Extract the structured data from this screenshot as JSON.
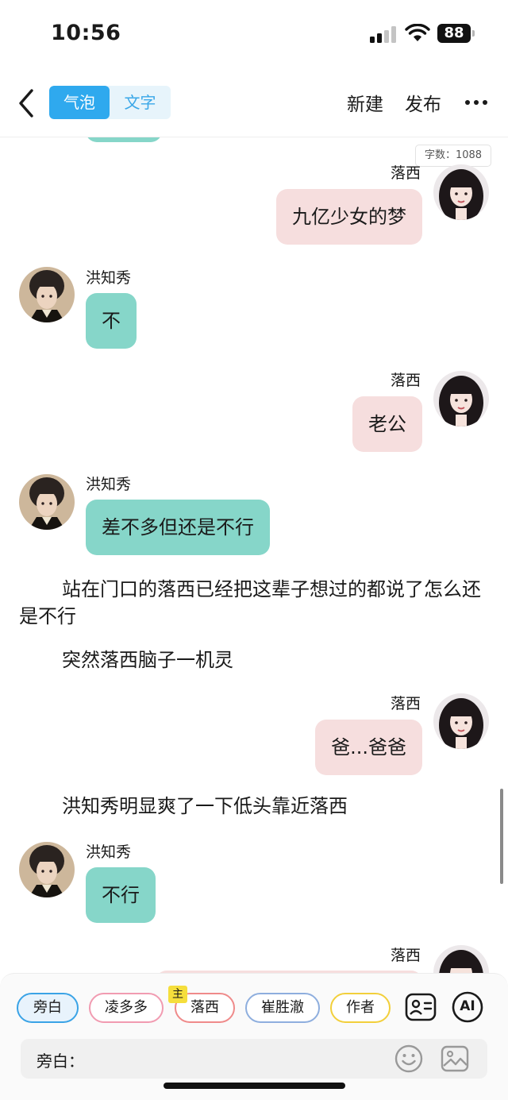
{
  "status_bar": {
    "time": "10:56",
    "battery": "88"
  },
  "nav": {
    "tabs": [
      {
        "label": "气泡"
      },
      {
        "label": "文字"
      }
    ],
    "new_label": "新建",
    "publish_label": "发布"
  },
  "word_count": "字数：1088",
  "messages": [
    {
      "type": "bubble",
      "side": "right",
      "name": "落西",
      "text": "九亿少女的梦"
    },
    {
      "type": "bubble",
      "side": "left",
      "name": "洪知秀",
      "text": "不"
    },
    {
      "type": "bubble",
      "side": "right",
      "name": "落西",
      "text": "老公"
    },
    {
      "type": "bubble",
      "side": "left",
      "name": "洪知秀",
      "text": "差不多但还是不行"
    },
    {
      "type": "narration",
      "text": "站在门口的落西已经把这辈子想过的都说了怎么还是不行"
    },
    {
      "type": "narration",
      "text": "突然落西脑子一机灵"
    },
    {
      "type": "bubble",
      "side": "right",
      "name": "落西",
      "text": "爸...爸爸"
    },
    {
      "type": "narration",
      "text": "洪知秀明显爽了一下低头靠近落西"
    },
    {
      "type": "bubble",
      "side": "left",
      "name": "洪知秀",
      "text": "不行"
    },
    {
      "type": "bubble",
      "side": "right",
      "name": "落西",
      "text": ""
    }
  ],
  "roles": [
    {
      "label": "旁白",
      "selected": true
    },
    {
      "label": "凌多多"
    },
    {
      "label": "落西",
      "badge": "主"
    },
    {
      "label": "崔胜澈"
    },
    {
      "label": "作者"
    }
  ],
  "ai_label": "AI",
  "input": {
    "label": "旁白："
  },
  "colors": {
    "accent_blue": "#2fa9ee",
    "left_bubble": "#86d6c9",
    "right_bubble": "#f6dede",
    "main_badge": "#f5de3c"
  },
  "icons": [
    "back-icon",
    "more-icon",
    "contact-card-icon",
    "ai-icon",
    "emoji-icon",
    "image-icon",
    "wifi-icon",
    "signal-icon"
  ]
}
